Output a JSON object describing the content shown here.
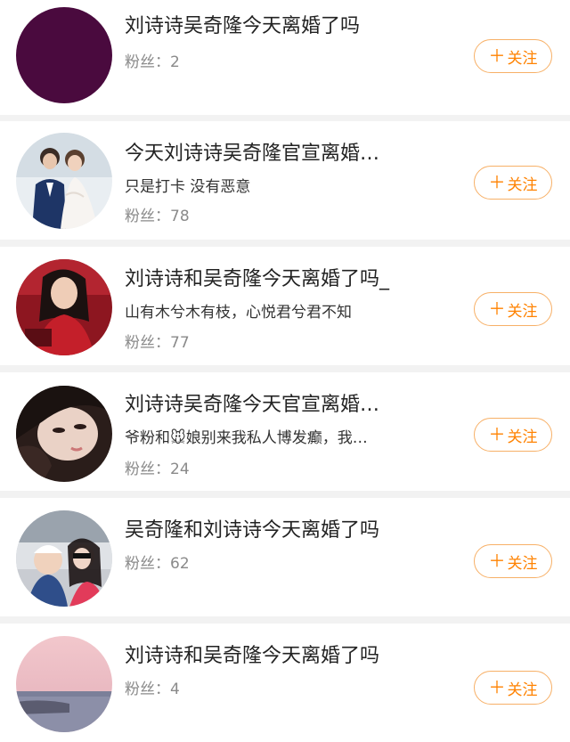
{
  "follow_label": "关注",
  "accent_color": "#ff8200",
  "results": [
    {
      "name": "刘诗诗吴奇隆今天离婚了吗",
      "desc": "",
      "fans_label": "粉丝：",
      "fans_count": "2",
      "avatar": "solid-plum-circle"
    },
    {
      "name": "今天刘诗诗吴奇隆官宣离婚…",
      "desc": "只是打卡 没有恶意",
      "fans_label": "粉丝：",
      "fans_count": "78",
      "avatar": "wedding-couple-photo"
    },
    {
      "name": "刘诗诗和吴奇隆今天离婚了吗_",
      "desc": "山有木兮木有枝，心悦君兮君不知",
      "fans_label": "粉丝：",
      "fans_count": "77",
      "avatar": "woman-in-red-photo"
    },
    {
      "name": "刘诗诗吴奇隆今天官宣离婚…",
      "desc": "爷粉和🐭娘别来我私人博发癫，我…",
      "fans_label": "粉丝：",
      "fans_count": "24",
      "avatar": "woman-face-closeup-photo"
    },
    {
      "name": "吴奇隆和刘诗诗今天离婚了吗",
      "desc": "",
      "fans_label": "粉丝：",
      "fans_count": "62",
      "avatar": "mother-and-child-photo"
    },
    {
      "name": "刘诗诗和吴奇隆今天离婚了吗",
      "desc": "",
      "fans_label": "粉丝：",
      "fans_count": "4",
      "avatar": "pink-sky-sea-photo"
    }
  ]
}
